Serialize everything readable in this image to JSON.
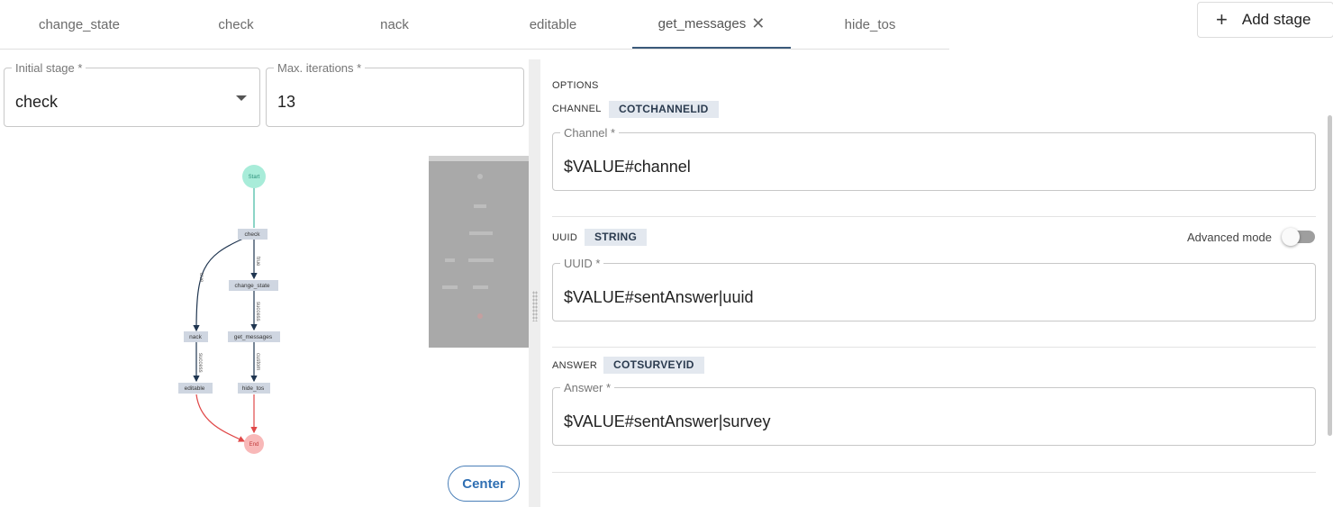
{
  "tabs": [
    {
      "label": "change_state",
      "active": false
    },
    {
      "label": "check",
      "active": false
    },
    {
      "label": "nack",
      "active": false
    },
    {
      "label": "editable",
      "active": false
    },
    {
      "label": "get_messages",
      "active": true
    },
    {
      "label": "hide_tos",
      "active": false
    }
  ],
  "add_stage": {
    "label": "Add stage",
    "icon": "plus-icon"
  },
  "initial_stage": {
    "label": "Initial stage *",
    "value": "check"
  },
  "max_iterations": {
    "label": "Max. iterations *",
    "value": "13"
  },
  "graph": {
    "nodes": {
      "start": "Start",
      "check": "check",
      "change_state": "change_state",
      "nack": "nack",
      "get_messages": "get_messages",
      "editable": "editable",
      "hide_tos": "hide_tos",
      "end": "End"
    },
    "edge_labels": {
      "check_nack": "true",
      "check_change_state": "true",
      "change_state_get_messages": "success",
      "nack_editable": "success",
      "get_messages_hide_tos": "custom"
    },
    "colors": {
      "start_node": "#a8ecd9",
      "end_node": "#f8b8b8",
      "task_node": "#cfd6e1",
      "edge": "#1f3550",
      "start_edge": "#3fb8a0",
      "end_edge": "#e04848"
    }
  },
  "center_button": "Center",
  "options": {
    "heading": "OPTIONS",
    "fields": [
      {
        "name": "CHANNEL",
        "type": "COTCHANNELID",
        "label": "Channel *",
        "value": "$VALUE#channel"
      },
      {
        "name": "UUID",
        "type": "STRING",
        "label": "UUID *",
        "value": "$VALUE#sentAnswer|uuid"
      },
      {
        "name": "ANSWER",
        "type": "COTSURVEYID",
        "label": "Answer *",
        "value": "$VALUE#sentAnswer|survey"
      }
    ],
    "advanced_mode": {
      "label": "Advanced mode",
      "enabled": false
    }
  }
}
